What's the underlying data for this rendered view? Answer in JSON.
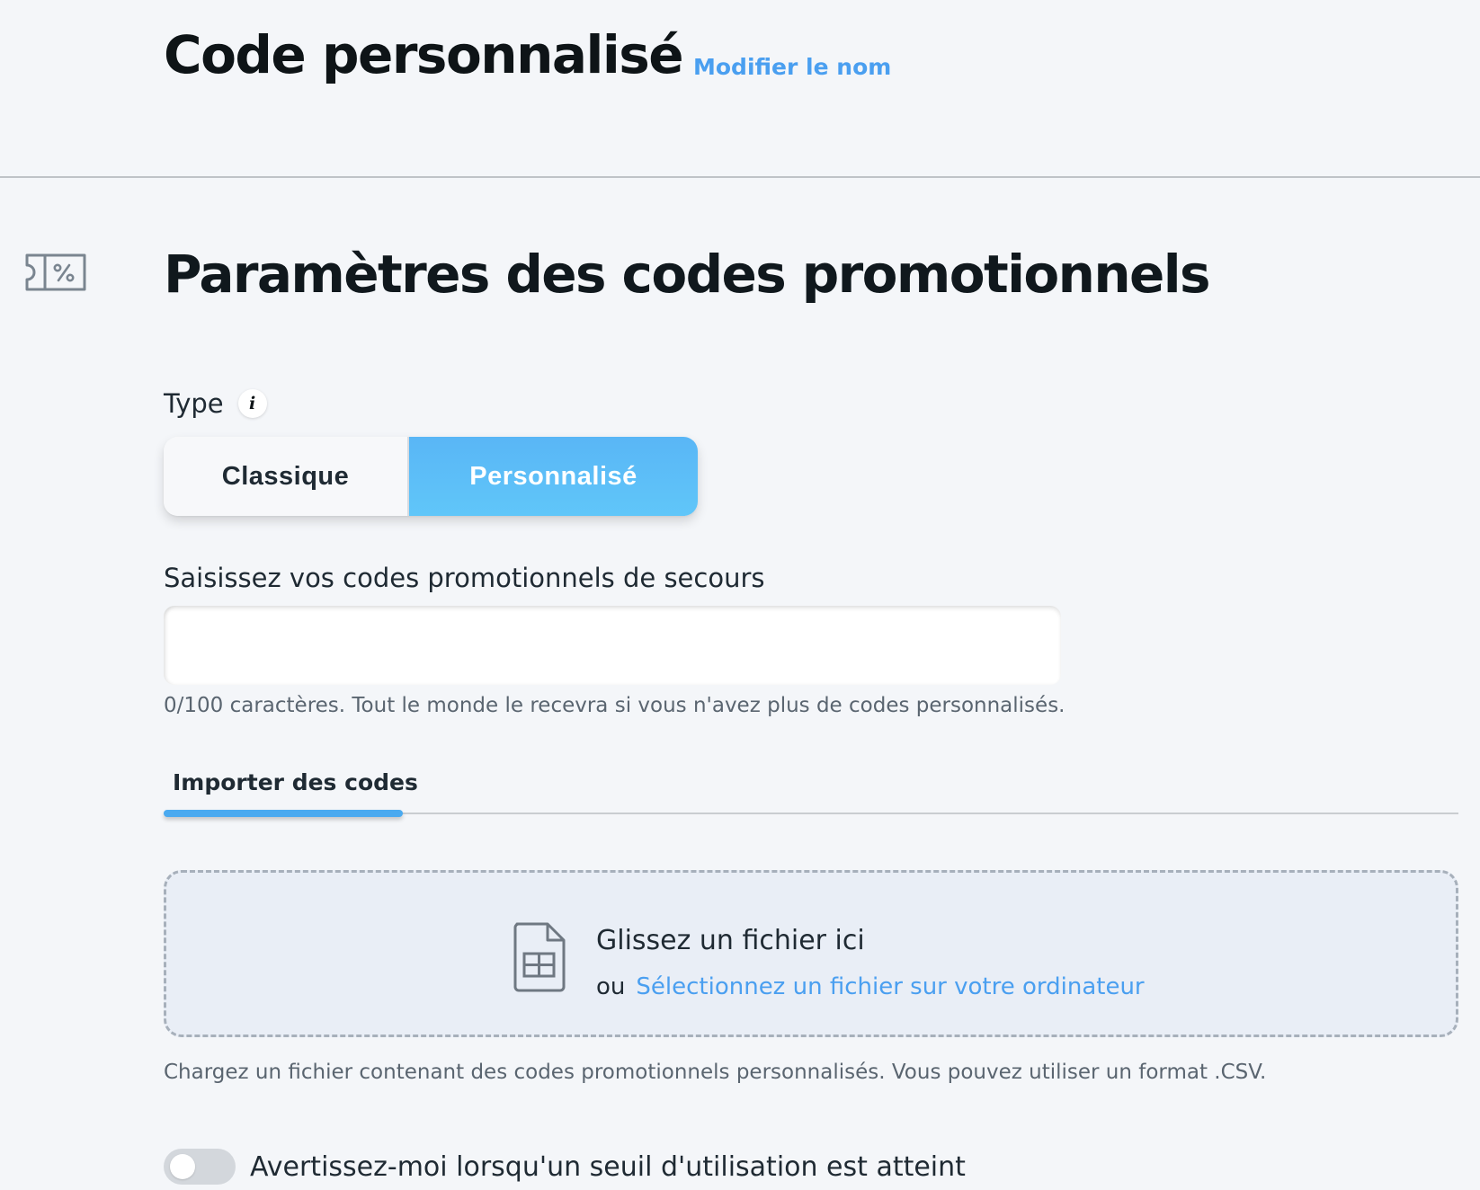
{
  "header": {
    "title": "Code personnalisé",
    "rename_link": "Modifier le nom"
  },
  "section": {
    "icon": "ticket-percent-icon",
    "title": "Paramètres des codes promotionnels"
  },
  "type_field": {
    "label": "Type",
    "info_icon": "info-icon",
    "info_glyph": "i",
    "options": [
      {
        "label": "Classique",
        "selected": false
      },
      {
        "label": "Personnalisé",
        "selected": true
      }
    ]
  },
  "fallback": {
    "label": "Saisissez vos codes promotionnels de secours",
    "value": "",
    "hint": "0/100 caractères. Tout le monde le recevra si vous n'avez plus de codes personnalisés."
  },
  "tabs": [
    {
      "label": "Importer des codes",
      "active": true
    }
  ],
  "upload": {
    "icon": "spreadsheet-file-icon",
    "title": "Glissez un fichier ici",
    "or_text": "ou",
    "select_link": "Sélectionnez un fichier sur votre ordinateur",
    "hint": "Chargez un fichier contenant des codes promotionnels personnalisés. Vous pouvez utiliser un format .CSV."
  },
  "threshold_toggle": {
    "label": "Avertissez-moi lorsqu'un seuil d'utilisation est atteint",
    "checked": false
  },
  "colors": {
    "background": "#f4f6f9",
    "accent": "#4a9ff0",
    "selected_segment": "#5dbdf7",
    "text": "#1f2a33"
  }
}
